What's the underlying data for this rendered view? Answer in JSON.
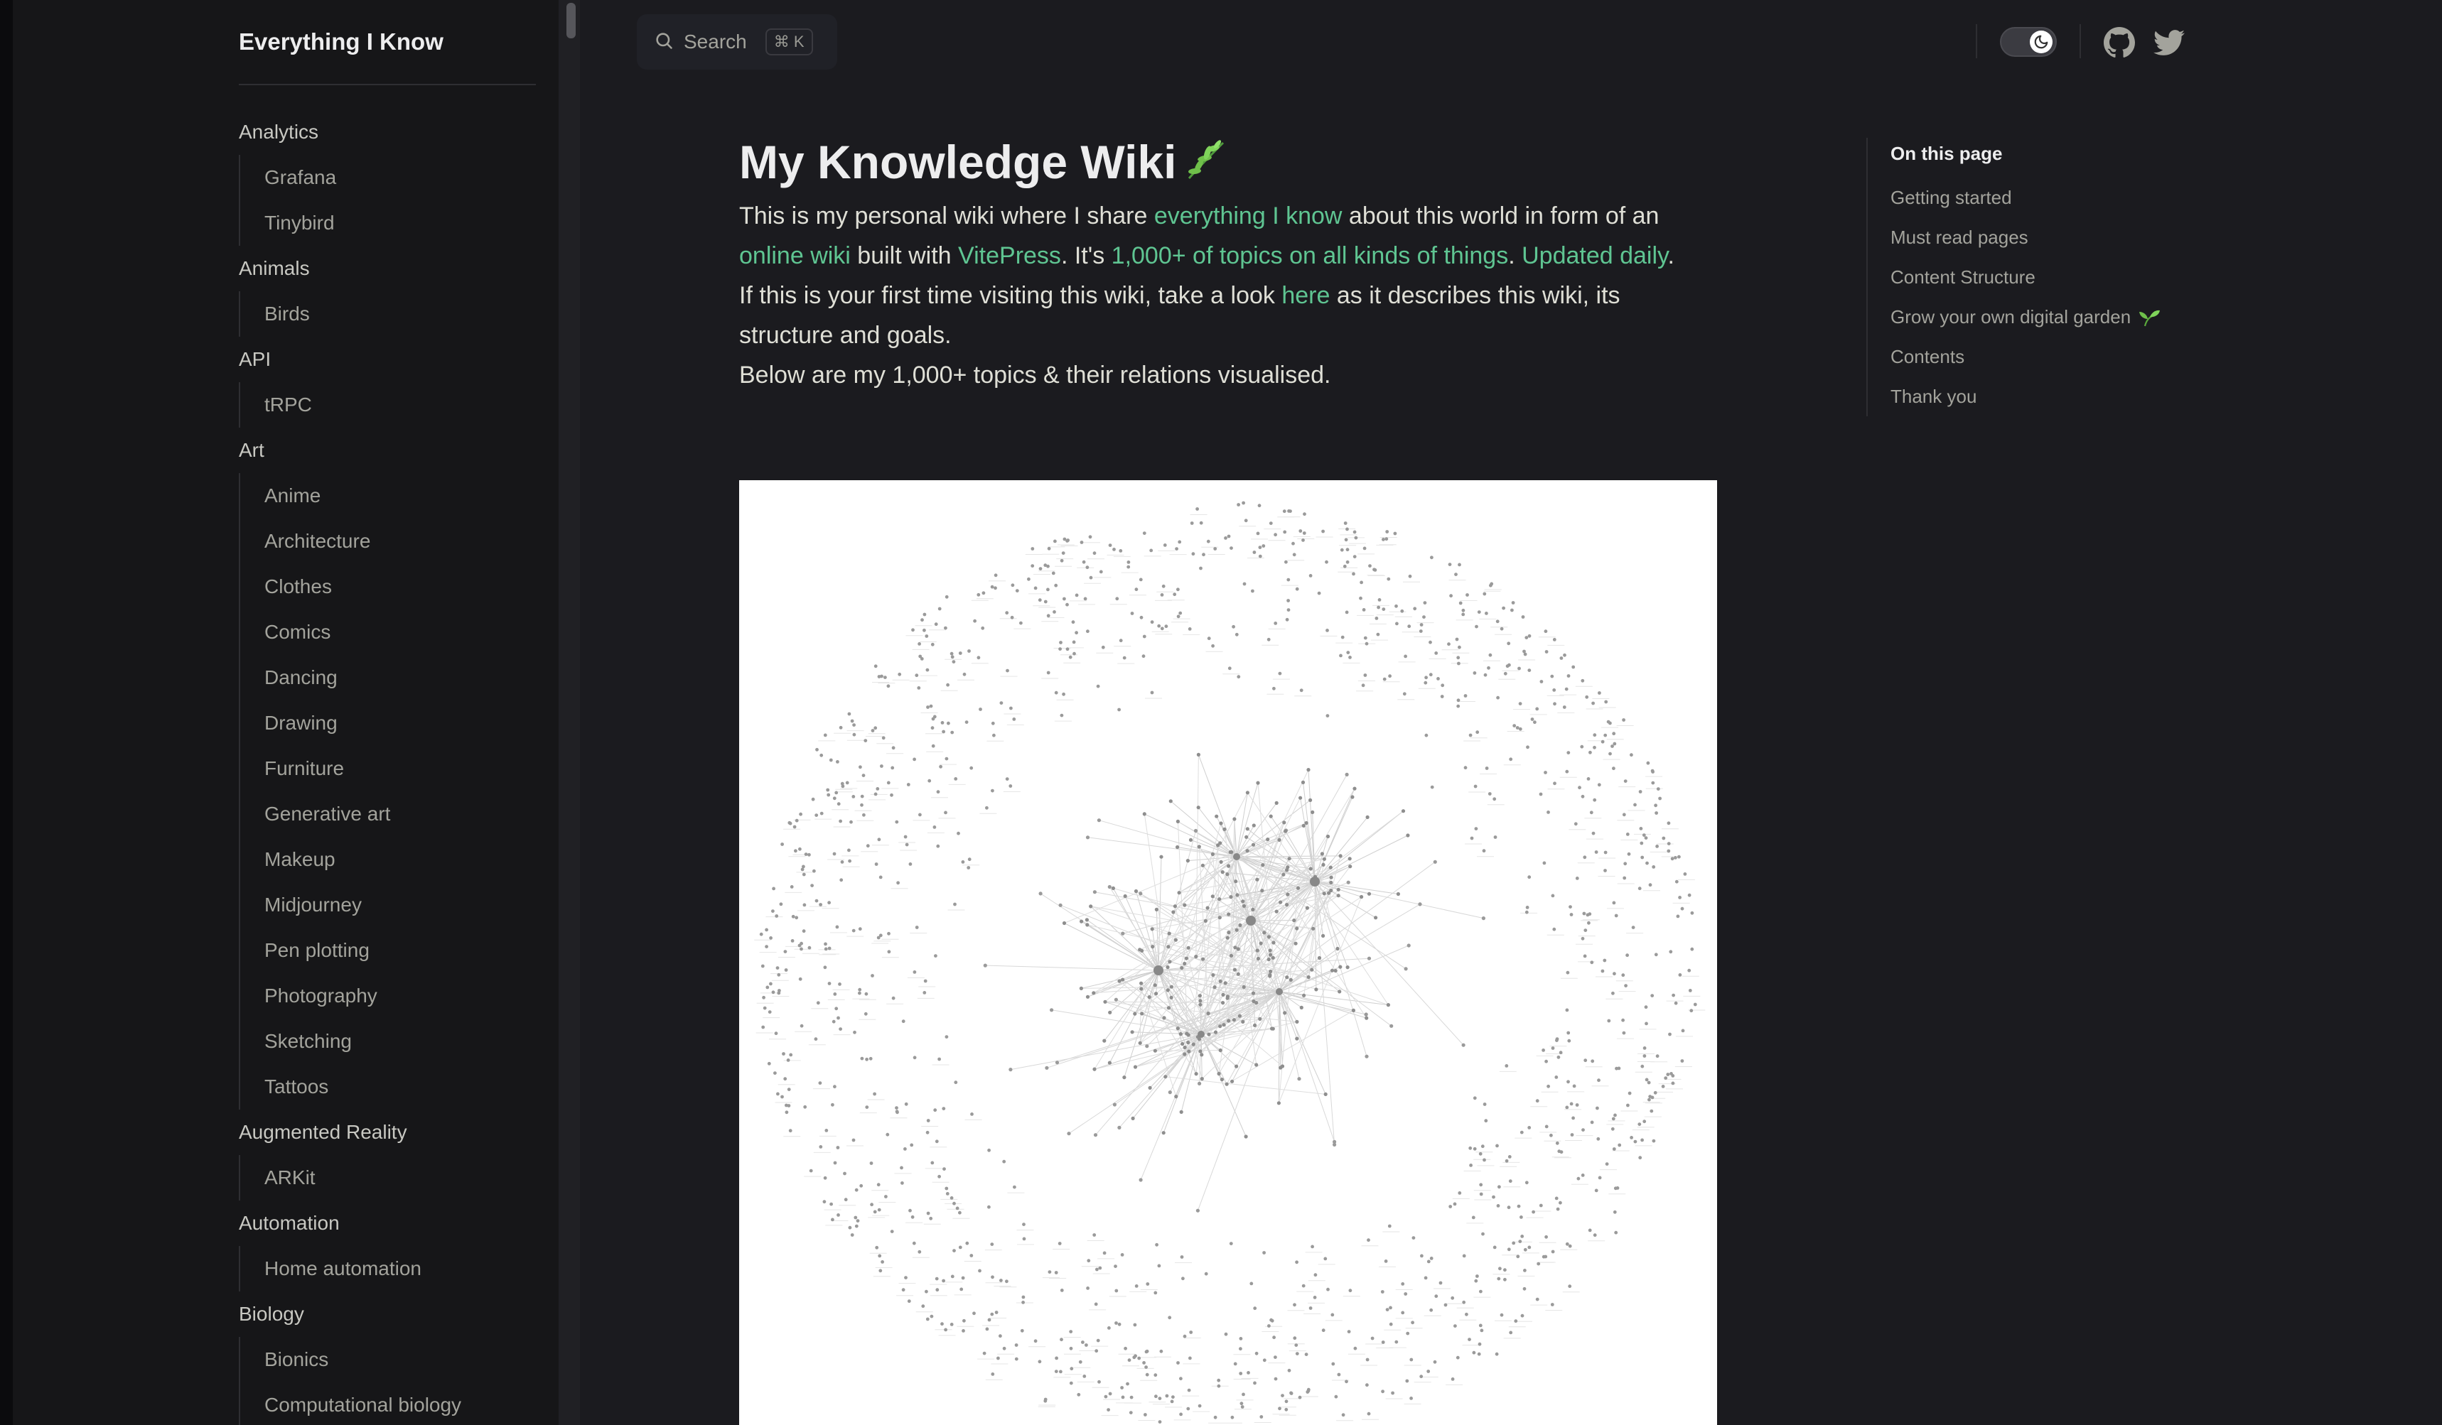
{
  "site": {
    "title": "Everything I Know"
  },
  "sidebar": {
    "groups": [
      {
        "title": "Analytics",
        "items": [
          "Grafana",
          "Tinybird"
        ]
      },
      {
        "title": "Animals",
        "items": [
          "Birds"
        ]
      },
      {
        "title": "API",
        "items": [
          "tRPC"
        ]
      },
      {
        "title": "Art",
        "items": [
          "Anime",
          "Architecture",
          "Clothes",
          "Comics",
          "Dancing",
          "Drawing",
          "Furniture",
          "Generative art",
          "Makeup",
          "Midjourney",
          "Pen plotting",
          "Photography",
          "Sketching",
          "Tattoos"
        ]
      },
      {
        "title": "Augmented Reality",
        "items": [
          "ARKit"
        ]
      },
      {
        "title": "Automation",
        "items": [
          "Home automation"
        ]
      },
      {
        "title": "Biology",
        "items": [
          "Bionics",
          "Computational biology"
        ]
      }
    ]
  },
  "topbar": {
    "search_label": "Search",
    "search_shortcut": "⌘ K"
  },
  "icons": {
    "search": "search-icon",
    "theme": "moon-icon",
    "github": "github-icon",
    "twitter": "twitter-icon",
    "title_emoji": "herb-emoji",
    "toc_emoji": "seedling-emoji"
  },
  "colors": {
    "accent": "#5fc592",
    "background": "#1b1b1f",
    "sidebar": "#161618"
  },
  "page": {
    "title": "My Knowledge Wiki",
    "p1": {
      "t1": "This is my personal wiki where I share ",
      "link1": "everything I know",
      "t2": " about this world in form of an ",
      "link2": "online wiki",
      "t3": " built with ",
      "link3": "VitePress",
      "t4": ". It's ",
      "link4": "1,000+ of topics on all kinds of things",
      "t5": ". ",
      "link5": "Updated daily",
      "t6": "."
    },
    "p2": {
      "t1": "If this is your first time visiting this wiki, take a look ",
      "link1": "here",
      "t2": " as it describes this wiki, its structure and goals."
    },
    "p3": "Below are my 1,000+ topics & their relations visualised."
  },
  "toc": {
    "title": "On this page",
    "items": [
      "Getting started",
      "Must read pages",
      "Content Structure",
      "Grow your own digital garden",
      "Contents",
      "Thank you"
    ]
  }
}
